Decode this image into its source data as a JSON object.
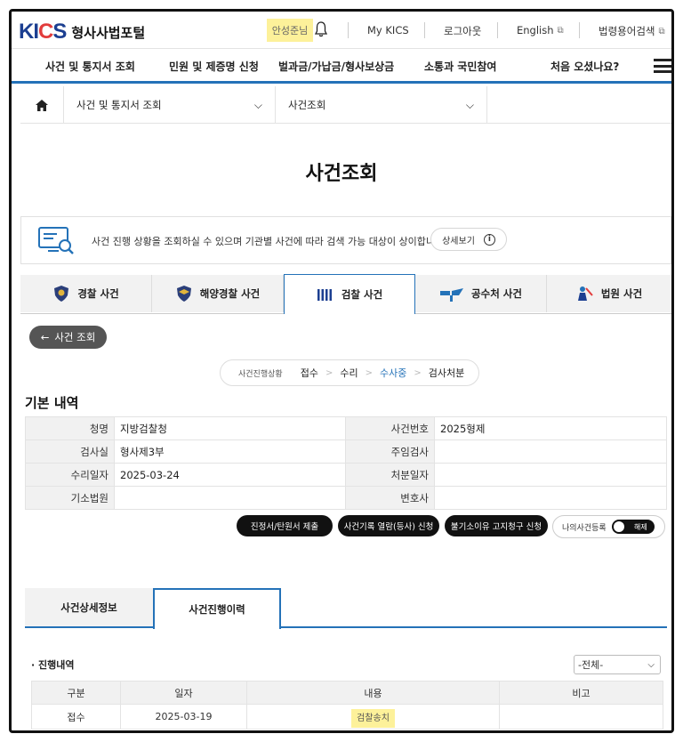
{
  "header": {
    "logo_text": "KICS",
    "portal_name": "형사사법포털",
    "user_name": "안성준님",
    "util_links": [
      "My KICS",
      "로그아웃",
      "English",
      "법령용어검색"
    ]
  },
  "main_nav": [
    "사건 및 통지서 조회",
    "민원 및 제증명 신청",
    "벌과금/가납금/형사보상금",
    "소통과 국민참여",
    "처음 오셨나요?"
  ],
  "breadcrumb": {
    "level1": "사건 및 통지서 조회",
    "level2": "사건조회"
  },
  "page_title": "사건조회",
  "info": {
    "text": "사건 진행 상황을 조회하실 수 있으며 기관별 사건에 따라 검색 가능 대상이 상이합니다.",
    "detail_label": "상세보기"
  },
  "agency_tabs": [
    "경찰 사건",
    "해양경찰 사건",
    "검찰 사건",
    "공수처 사건",
    "법원 사건"
  ],
  "back_label": "사건 조회",
  "progress": {
    "label": "사건진행상황",
    "steps": [
      "접수",
      "수리",
      "수사중",
      "검사처분"
    ],
    "current": "수사중"
  },
  "basic_info": {
    "title": "기본 내역",
    "rows": [
      {
        "l1": "청명",
        "v1": "지방검찰청",
        "l2": "사건번호",
        "v2": "2025형제"
      },
      {
        "l1": "검사실",
        "v1": "형사제3부",
        "l2": "주임검사",
        "v2": ""
      },
      {
        "l1": "수리일자",
        "v1": "2025-03-24",
        "l2": "처분일자",
        "v2": ""
      },
      {
        "l1": "기소법원",
        "v1": "",
        "l2": "변호사",
        "v2": ""
      }
    ]
  },
  "actions": {
    "petition": "진정서/탄원서 제출",
    "record_view": "사건기록 열람(등사) 신청",
    "non_indict": "불기소이유 고지청구 신청",
    "my_case_label": "나의사건등록",
    "toggle_label": "해제"
  },
  "detail_tabs": [
    "사건상세정보",
    "사건진행이력"
  ],
  "history": {
    "title": "· 진행내역",
    "filter_selected": "-전체-",
    "columns": [
      "구분",
      "일자",
      "내용",
      "비고"
    ],
    "rows": [
      {
        "type": "접수",
        "date": "2025-03-19",
        "content": "검찰송치",
        "note": ""
      }
    ]
  }
}
